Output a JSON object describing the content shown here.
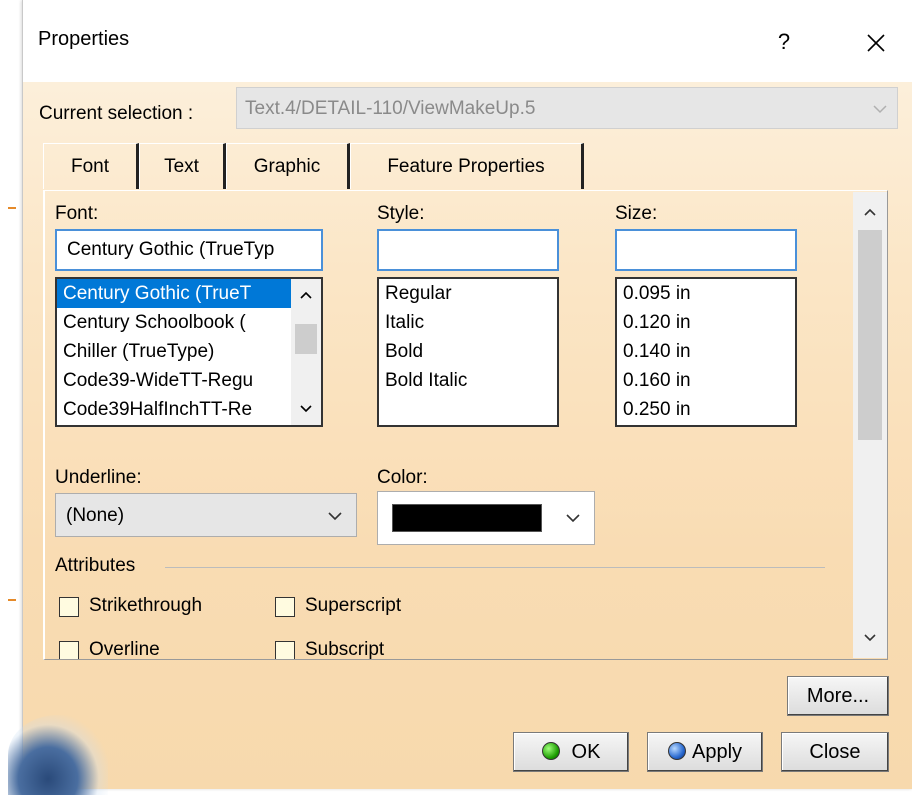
{
  "dialog": {
    "title": "Properties",
    "help_label": "?",
    "current_selection_label": "Current selection :",
    "current_selection_value": "Text.4/DETAIL-110/ViewMakeUp.5"
  },
  "tabs": [
    {
      "label": "Font",
      "active": true
    },
    {
      "label": "Text",
      "active": false
    },
    {
      "label": "Graphic",
      "active": false
    },
    {
      "label": "Feature Properties",
      "active": false
    }
  ],
  "font_tab": {
    "font_label": "Font:",
    "font_value": "Century Gothic (TrueTyp",
    "font_list": [
      "Century Gothic (TrueT",
      "Century Schoolbook (",
      "Chiller (TrueType)",
      "Code39-WideTT-Regu",
      "Code39HalfInchTT-Re"
    ],
    "style_label": "Style:",
    "style_value": "",
    "style_list": [
      "Regular",
      "Italic",
      "Bold",
      "Bold Italic"
    ],
    "size_label": "Size:",
    "size_value": "",
    "size_list": [
      "0.095 in",
      "0.120 in",
      "0.140 in",
      "0.160 in",
      "0.250 in"
    ],
    "underline_label": "Underline:",
    "underline_value": "(None)",
    "color_label": "Color:",
    "color_value": "#000000",
    "attributes_label": "Attributes",
    "attributes": [
      "Strikethrough",
      "Superscript",
      "Overline",
      "Subscript"
    ]
  },
  "buttons": {
    "more": "More...",
    "ok": "OK",
    "apply": "Apply",
    "close": "Close"
  }
}
